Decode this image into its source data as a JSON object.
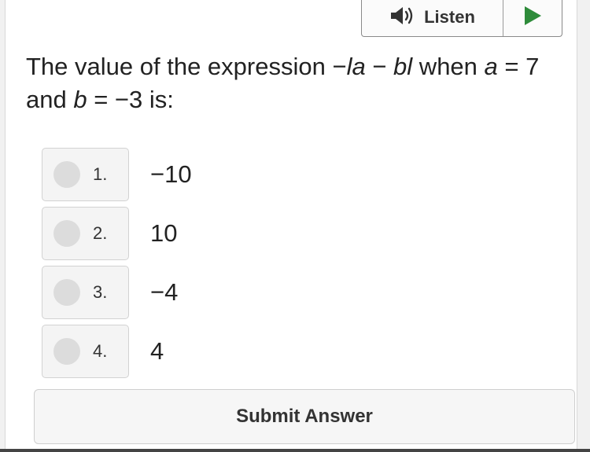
{
  "toolbar": {
    "listen_label": "Listen"
  },
  "question": {
    "t1": "The value of the expression −",
    "t2": "la",
    "t3": " − ",
    "t4": "bl",
    "t5": " when ",
    "t6": "a",
    "t7": " = 7 and ",
    "t8": "b",
    "t9": " = −3 is:"
  },
  "choices": [
    {
      "num": "1.",
      "text": "−10"
    },
    {
      "num": "2.",
      "text": "10"
    },
    {
      "num": "3.",
      "text": "−4"
    },
    {
      "num": "4.",
      "text": "4"
    }
  ],
  "submit_label": "Submit Answer",
  "colors": {
    "play": "#2e8b3a",
    "speaker": "#333333"
  }
}
